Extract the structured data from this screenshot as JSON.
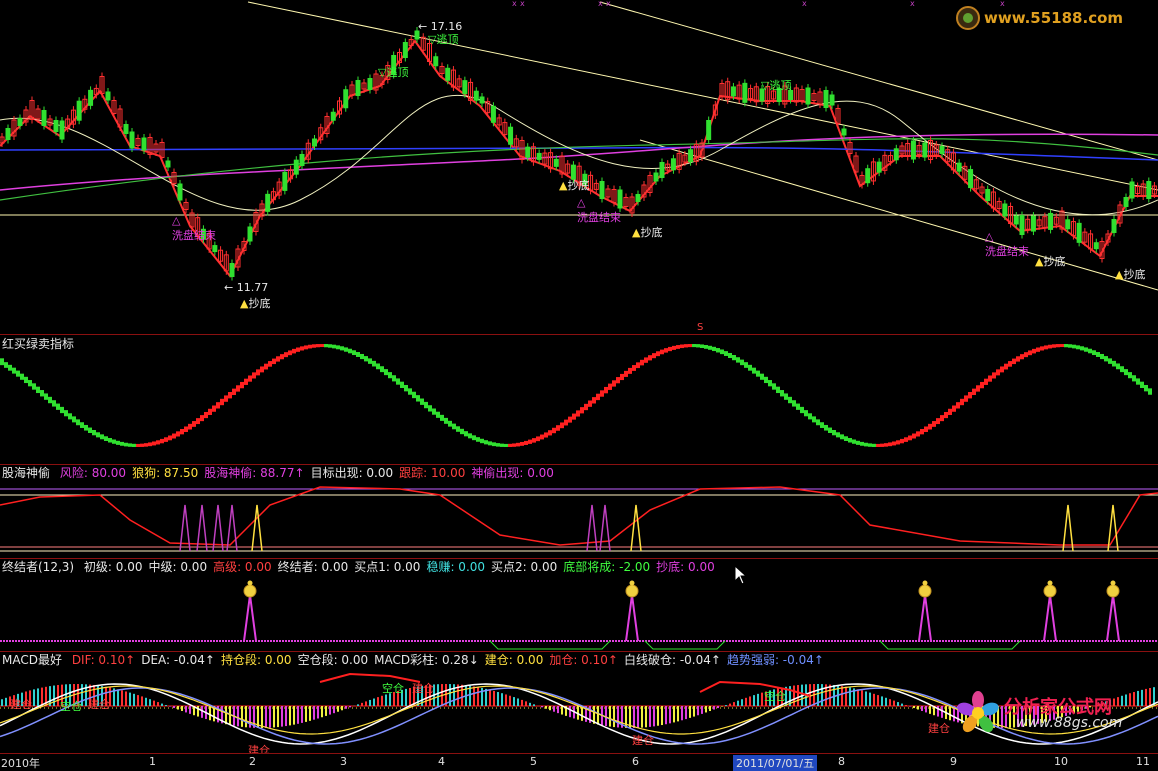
{
  "top_logo": {
    "url": "www.55188.com"
  },
  "price_panel": {
    "high_label": "17.16",
    "low_label": "11.77",
    "annotations": [
      {
        "id": "escape1",
        "text": "逃顶"
      },
      {
        "id": "escape2",
        "text": "逃顶"
      },
      {
        "id": "escape3",
        "text": "逃顶"
      },
      {
        "id": "wash1",
        "text": "洗盘结束"
      },
      {
        "id": "wash2",
        "text": "洗盘结束"
      },
      {
        "id": "wash3",
        "text": "洗盘结束"
      },
      {
        "id": "bottom1",
        "text": "抄底"
      },
      {
        "id": "bottom2",
        "text": "抄底"
      },
      {
        "id": "bottom3",
        "text": "抄底"
      },
      {
        "id": "bottom4",
        "text": "抄底"
      },
      {
        "id": "bottom5",
        "text": "抄底"
      }
    ],
    "marker_s": "S"
  },
  "panel2": {
    "title": "红买绿卖指标"
  },
  "panel3": {
    "name": "股海神偷",
    "items": [
      {
        "label": "风险:",
        "value": "80.00",
        "color": "#e040e0"
      },
      {
        "label": "狼狗:",
        "value": "87.50",
        "color": "#ffe040"
      },
      {
        "label": "股海神偷:",
        "value": "88.77",
        "color": "#e040e0",
        "arrow": "↑"
      },
      {
        "label": "目标出现:",
        "value": "0.00",
        "color": "#e8e8e8"
      },
      {
        "label": "跟踪:",
        "value": "10.00",
        "color": "#ff4040"
      },
      {
        "label": "神偷出现:",
        "value": "0.00",
        "color": "#e040e0"
      }
    ]
  },
  "panel4": {
    "name": "终结者(12,3)",
    "items": [
      {
        "label": "初级:",
        "value": "0.00",
        "color": "#e8e8e8"
      },
      {
        "label": "中级:",
        "value": "0.00",
        "color": "#e8e8e8"
      },
      {
        "label": "高级:",
        "value": "0.00",
        "color": "#ff4040"
      },
      {
        "label": "终结者:",
        "value": "0.00",
        "color": "#e8e8e8"
      },
      {
        "label": "买点1:",
        "value": "0.00",
        "color": "#e8e8e8"
      },
      {
        "label": "稳赚:",
        "value": "0.00",
        "color": "#40e0e0"
      },
      {
        "label": "买点2:",
        "value": "0.00",
        "color": "#e8e8e8"
      },
      {
        "label": "底部将成:",
        "value": "-2.00",
        "color": "#40ff40"
      },
      {
        "label": "抄底:",
        "value": "0.00",
        "color": "#e040e0"
      }
    ]
  },
  "panel5": {
    "name": "MACD最好",
    "items": [
      {
        "label": "DIF:",
        "value": "0.10",
        "color": "#ff4040",
        "arrow": "↑"
      },
      {
        "label": "DEA:",
        "value": "-0.04",
        "color": "#e8e8e8",
        "arrow": "↑"
      },
      {
        "label": "持仓段:",
        "value": "0.00",
        "color": "#ffe040"
      },
      {
        "label": "空仓段:",
        "value": "0.00",
        "color": "#e8e8e8"
      },
      {
        "label": "MACD彩柱:",
        "value": "0.28",
        "color": "#e8e8e8",
        "arrow": "↓"
      },
      {
        "label": "建仓:",
        "value": "0.00",
        "color": "#ffe040"
      },
      {
        "label": "加仓:",
        "value": "0.10",
        "color": "#ff4040",
        "arrow": "↑"
      },
      {
        "label": "白线破仓:",
        "value": "-0.04",
        "color": "#e8e8e8",
        "arrow": "↑"
      },
      {
        "label": "趋势强弱:",
        "value": "-0.04",
        "color": "#6f8fff",
        "arrow": "↑"
      }
    ],
    "annotations": [
      "建仓",
      "空仓",
      "建仓",
      "空仓",
      "建仓",
      "建仓",
      "空仓",
      "建仓",
      "建仓"
    ]
  },
  "xaxis": {
    "labels": [
      "2010年",
      "1",
      "2",
      "3",
      "4",
      "5",
      "6",
      "2011/07/01/五",
      "8",
      "9",
      "10",
      "11"
    ]
  },
  "bottom_logo": {
    "name": "分析家公式网",
    "url": "www.88gs.com"
  }
}
